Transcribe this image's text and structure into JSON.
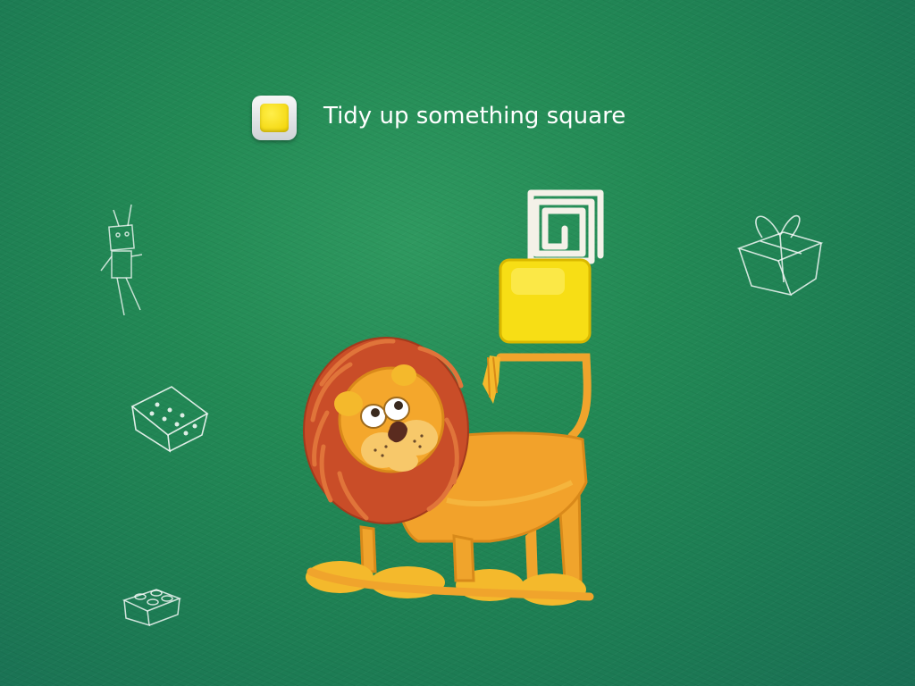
{
  "task": {
    "icon": "yellow-square-icon",
    "text": "Tidy up something square"
  },
  "scene": {
    "sketch_items": [
      "robot-sketch",
      "gift-box-sketch",
      "dice-sketch",
      "lego-brick-sketch"
    ],
    "objects": [
      "white-square-spiral",
      "yellow-square-block",
      "clay-lion"
    ]
  },
  "colors": {
    "background": "#238a55",
    "lion_body": "#f2a22b",
    "lion_mane": "#c94d28",
    "yellow_block": "#f7de15",
    "white_spiral": "#f4f1e8"
  }
}
